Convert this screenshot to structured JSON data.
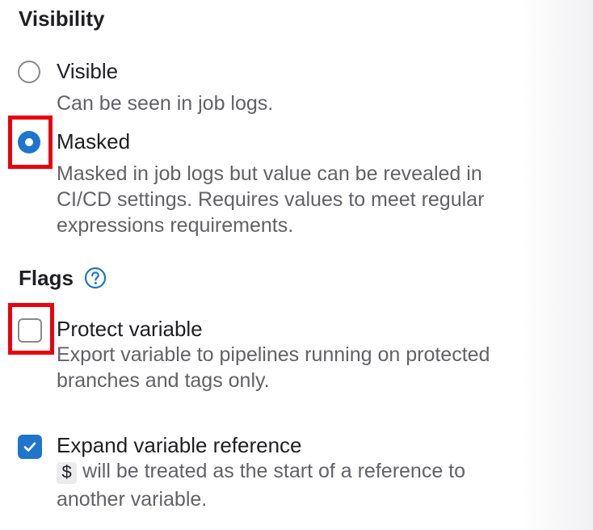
{
  "visibility": {
    "title": "Visibility",
    "options": [
      {
        "label": "Visible",
        "description": "Can be seen in job logs.",
        "selected": false
      },
      {
        "label": "Masked",
        "description_lines": [
          "Masked in job logs but value can be revealed in",
          "CI/CD settings. Requires values to meet regular",
          "expressions requirements."
        ],
        "selected": true
      }
    ]
  },
  "flags": {
    "title": "Flags",
    "help_icon": "question-circle-icon",
    "items": [
      {
        "label": "Protect variable",
        "description_lines": [
          "Export variable to pipelines running on protected",
          "branches and tags only."
        ],
        "checked": false
      },
      {
        "label": "Expand variable reference",
        "code": "$",
        "description_lines": [
          "will be treated as the start of a reference to",
          "another variable."
        ],
        "checked": true
      }
    ]
  },
  "colors": {
    "accent": "#1f75cb",
    "highlight": "#e8020b",
    "muted_text": "#626168"
  }
}
